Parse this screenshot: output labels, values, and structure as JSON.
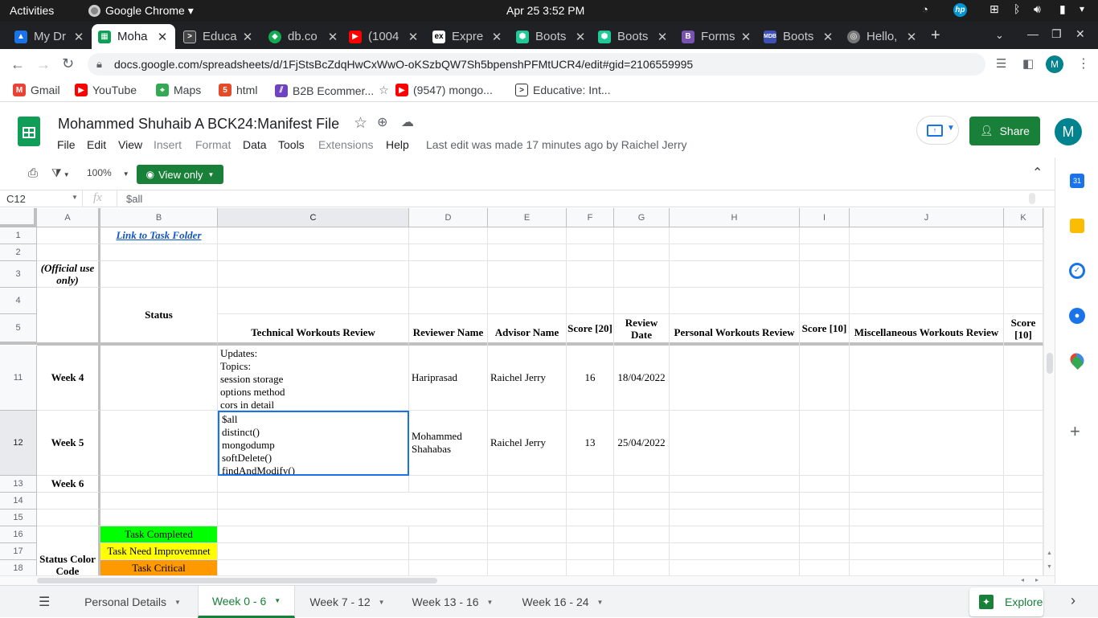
{
  "system_bar": {
    "activities": "Activities",
    "app_name": "Google Chrome",
    "datetime": "Apr 25   3:52 PM"
  },
  "browser_tabs": [
    {
      "title": "My Dr",
      "color": "#1a73e8"
    },
    {
      "title": "Moha",
      "color": "#0f9d58",
      "active": true
    },
    {
      "title": "Educa",
      "color": "#444444"
    },
    {
      "title": "db.co",
      "color": "#13aa52"
    },
    {
      "title": "(1004",
      "color": "#ff0000"
    },
    {
      "title": "Expre",
      "color": "#333333"
    },
    {
      "title": "Boots",
      "color": "#20c997"
    },
    {
      "title": "Boots",
      "color": "#20c997"
    },
    {
      "title": "Forms",
      "color": "#7952b3"
    },
    {
      "title": "Boots",
      "color": "#3f51b5"
    },
    {
      "title": "Hello,",
      "color": "#777777"
    }
  ],
  "address_bar": {
    "url": "docs.google.com/spreadsheets/d/1FjStsBcZdqHwCxWwO-oKSzbQW7Sh5bpenshPFMtUCR4/edit#gid=2106559995",
    "profile_initial": "M"
  },
  "bookmarks": [
    {
      "label": "Gmail",
      "color": "#ea4335"
    },
    {
      "label": "YouTube",
      "color": "#ff0000"
    },
    {
      "label": "Maps",
      "color": "#34a853"
    },
    {
      "label": "html",
      "color": "#e34c26"
    },
    {
      "label": "B2B Ecommer...",
      "color": "#6f42c1"
    },
    {
      "label": "(9547) mongo...",
      "color": "#ff0000"
    },
    {
      "label": "Educative: Int...",
      "color": "#333333"
    }
  ],
  "doc": {
    "title": "Mohammed Shuhaib A BCK24:Manifest File",
    "menus": [
      "File",
      "Edit",
      "View",
      "Insert",
      "Format",
      "Data",
      "Tools",
      "Extensions",
      "Help"
    ],
    "last_edit": "Last edit was made 17 minutes ago by Raichel Jerry",
    "share_label": "Share",
    "account_initial": "M"
  },
  "toolbar": {
    "zoom": "100%",
    "view_only": "View only"
  },
  "formula_bar": {
    "cell_ref": "C12",
    "fx": "fx",
    "content": "$all"
  },
  "grid": {
    "columns": [
      "A",
      "B",
      "C",
      "D",
      "E",
      "F",
      "G",
      "H",
      "I",
      "J",
      "K"
    ],
    "rows": [
      "1",
      "2",
      "3",
      "4",
      "5",
      "11",
      "12",
      "13",
      "14",
      "15",
      "16",
      "17",
      "18"
    ],
    "link_to_task_folder": "Link to Task Folder",
    "official_use": "(Official use only)",
    "status": "Status",
    "headers": {
      "technical": "Technical Workouts Review",
      "reviewer": "Reviewer Name",
      "advisor": "Advisor Name",
      "score20": "Score [20]",
      "review_date": "Review Date",
      "personal": "Personal Workouts Review",
      "score10a": "Score [10]",
      "misc": "Miscellaneous Workouts Review",
      "score10b": "Score [10]"
    },
    "week4": {
      "label": "Week 4",
      "technical": [
        "Updates:",
        "Topics:",
        "session storage",
        "options method",
        "cors in detail"
      ],
      "reviewer": "Hariprasad",
      "advisor": "Raichel Jerry",
      "score": "16",
      "date": "18/04/2022"
    },
    "week5": {
      "label": "Week 5",
      "technical": [
        "$all",
        "distinct()",
        "mongodump",
        "softDelete()",
        "findAndModify()"
      ],
      "reviewer": "Mohammed Shahabas",
      "advisor": "Raichel Jerry",
      "score": "13",
      "date": "25/04/2022"
    },
    "week6": {
      "label": "Week 6"
    },
    "legend": {
      "completed": "Task Completed",
      "improvement": "Task Need Improvemnet",
      "critical": "Task Critical",
      "status_color": "Status Color Code",
      "completed_color": "#00ff00",
      "improvement_color": "#ffff00",
      "critical_color": "#ff9900"
    }
  },
  "sheet_tabs": [
    "Personal Details",
    "Week 0 - 6",
    "Week 7 - 12",
    "Week 13 - 16",
    "Week 16 - 24"
  ],
  "explore_label": "Explore"
}
